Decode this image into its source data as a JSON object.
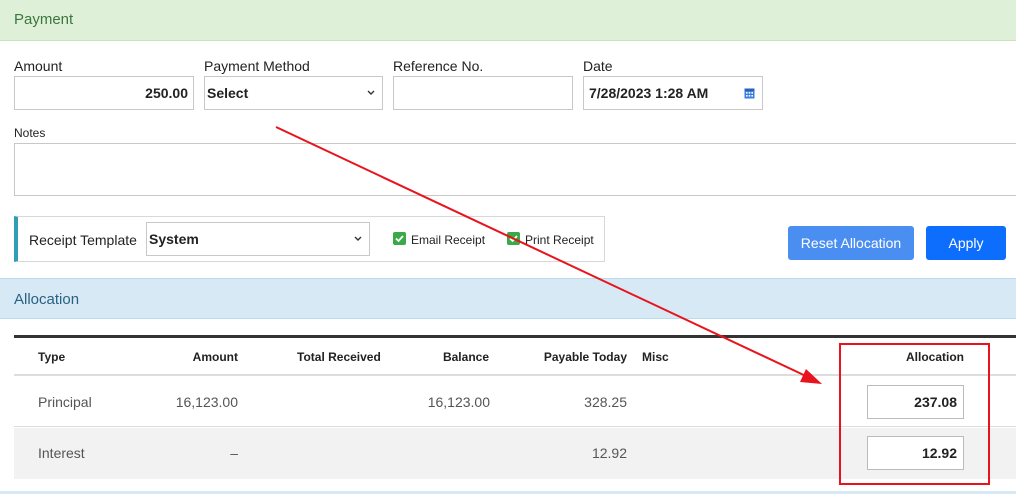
{
  "payment_section": {
    "title": "Payment",
    "amount": {
      "label": "Amount",
      "value": "250.00"
    },
    "payment_method": {
      "label": "Payment Method",
      "value": "Select"
    },
    "reference": {
      "label": "Reference No.",
      "value": ""
    },
    "date": {
      "label": "Date",
      "value": "7/28/2023 1:28 AM",
      "icon": "calendar-icon"
    },
    "notes": {
      "label": "Notes",
      "value": ""
    }
  },
  "receipt": {
    "template_label": "Receipt Template",
    "template_value": "System",
    "email_receipt": {
      "label": "Email Receipt",
      "checked": true
    },
    "print_receipt": {
      "label": "Print Receipt",
      "checked": true
    }
  },
  "buttons": {
    "reset_allocation": "Reset Allocation",
    "apply": "Apply"
  },
  "allocation_section": {
    "title": "Allocation",
    "columns": [
      "Type",
      "Amount",
      "Total Received",
      "Balance",
      "Payable Today",
      "Misc",
      "Allocation"
    ],
    "rows": [
      {
        "type": "Principal",
        "amount": "16,123.00",
        "total_received": "",
        "balance": "16,123.00",
        "payable_today": "328.25",
        "misc": "",
        "allocation": "237.08"
      },
      {
        "type": "Interest",
        "amount": "–",
        "total_received": "",
        "balance": "",
        "payable_today": "12.92",
        "misc": "",
        "allocation": "12.92"
      }
    ]
  },
  "colors": {
    "payment_header_bg": "#dff0d8",
    "allocation_header_bg": "#d6e9f5",
    "apply_button": "#0d6efd",
    "reset_button": "#4a8ef2",
    "annotation_red": "#e8131c",
    "checkbox_green": "#3aa948"
  }
}
